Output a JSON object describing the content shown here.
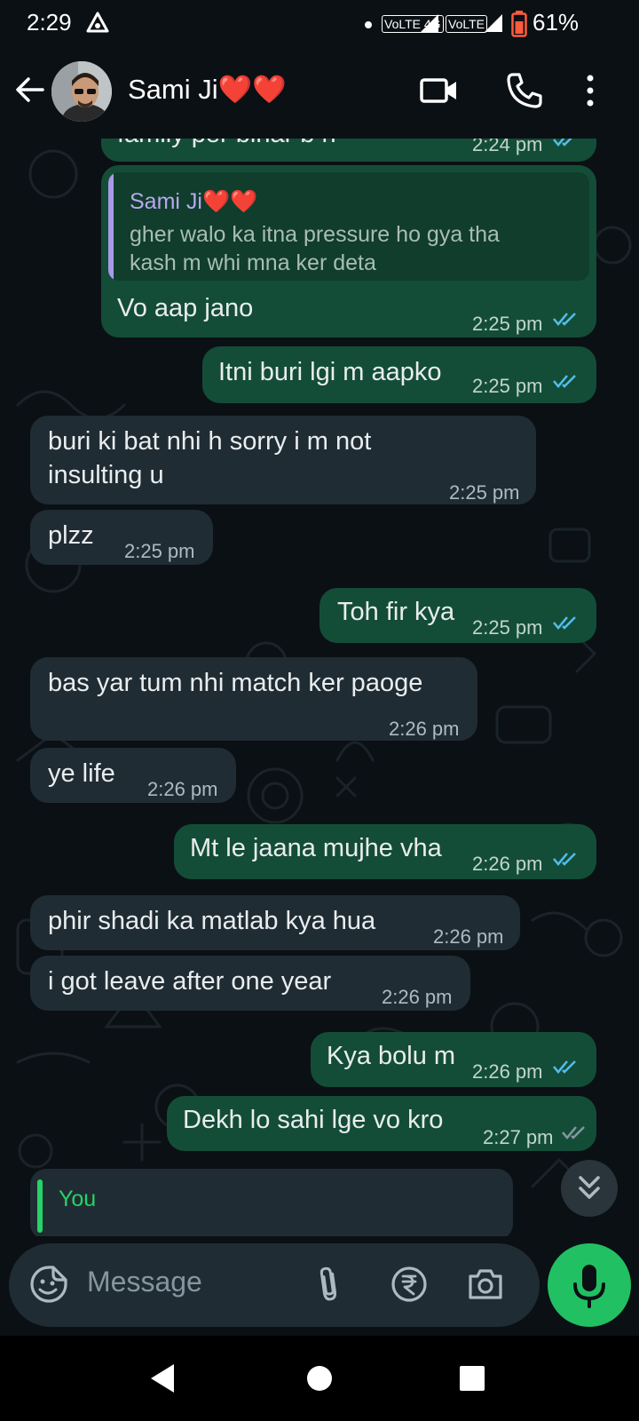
{
  "status_bar": {
    "time": "2:29",
    "network_1": "VoLTE 4G",
    "network_2": "VoLTE",
    "battery_percent": "61%"
  },
  "header": {
    "contact_name": "Sami Ji❤️❤️",
    "icons": [
      "back-arrow-icon",
      "video-call-icon",
      "phone-call-icon",
      "more-options-icon"
    ]
  },
  "chat": {
    "partial_top_message": {
      "text": "family per bihar b h",
      "time": "2:24 pm"
    },
    "messages": [
      {
        "direction": "out",
        "quote": {
          "name": "Sami Ji❤️❤️",
          "line1": "gher walo ka itna pressure ho gya tha",
          "line2": "kash m whi mna ker deta"
        },
        "text": "Vo aap jano",
        "time": "2:25 pm",
        "status": "read"
      },
      {
        "direction": "out",
        "text": "Itni buri lgi m aapko",
        "time": "2:25 pm",
        "status": "read"
      },
      {
        "direction": "in",
        "line1": "buri ki bat nhi h  sorry i m not",
        "line2": "insulting u",
        "time": "2:25 pm"
      },
      {
        "direction": "in",
        "text": "plzz",
        "time": "2:25 pm"
      },
      {
        "direction": "out",
        "text": "Toh fir kya",
        "time": "2:25 pm",
        "status": "read"
      },
      {
        "direction": "in",
        "text": "bas yar tum nhi match ker paoge",
        "time": "2:26 pm"
      },
      {
        "direction": "in",
        "text": "ye life",
        "time": "2:26 pm"
      },
      {
        "direction": "out",
        "text": "Mt le jaana mujhe vha",
        "time": "2:26 pm",
        "status": "read"
      },
      {
        "direction": "in",
        "text": "phir shadi ka matlab kya hua",
        "time": "2:26 pm"
      },
      {
        "direction": "in",
        "text": "i got leave after one year",
        "time": "2:26 pm"
      },
      {
        "direction": "out",
        "text": "Kya bolu m",
        "time": "2:26 pm",
        "status": "read"
      },
      {
        "direction": "out",
        "text": "Dekh lo sahi lge vo kro",
        "time": "2:27 pm",
        "status": "read"
      }
    ],
    "reply_peek_name": "You"
  },
  "composer": {
    "placeholder": "Message",
    "icons": [
      "sticker-icon",
      "attach-icon",
      "rupee-payment-icon",
      "camera-icon",
      "mic-icon"
    ]
  },
  "colors": {
    "background": "#0b1014",
    "outgoing_bubble": "#144d37",
    "incoming_bubble": "#202c33",
    "read_tick": "#53bdeb",
    "mic_button": "#21c063"
  }
}
